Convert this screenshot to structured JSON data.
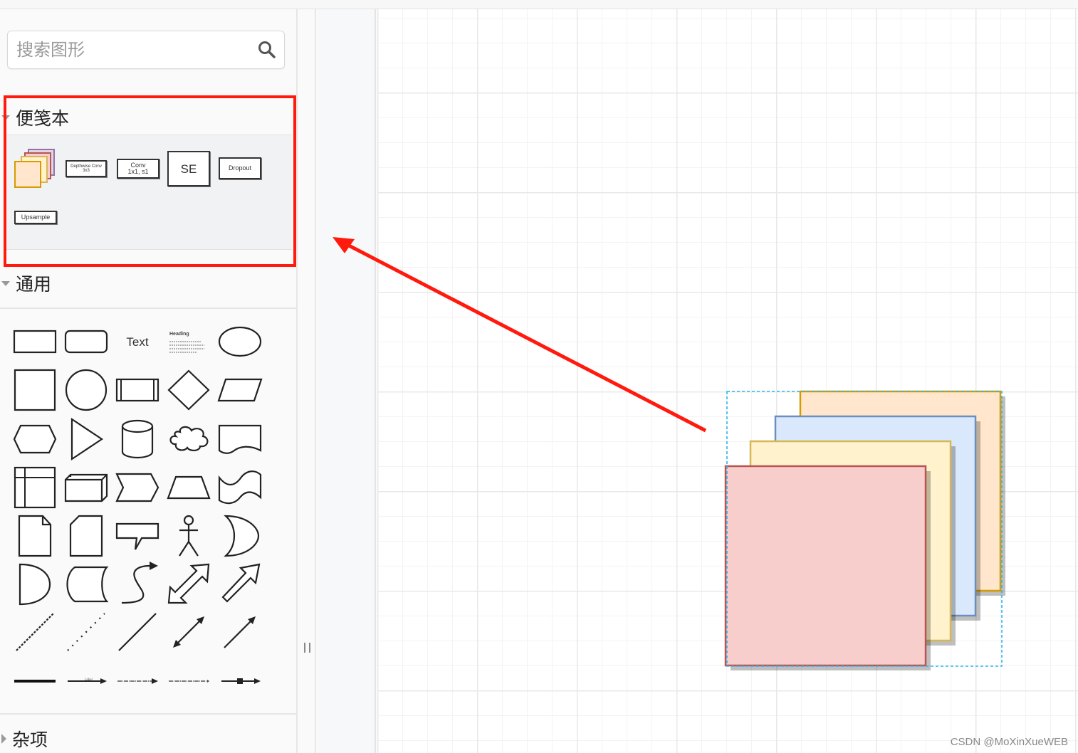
{
  "search": {
    "placeholder": "搜索图形",
    "icon": "search-icon"
  },
  "scratchpad": {
    "title": "便笺本",
    "expanded": true,
    "actions": [
      {
        "name": "help",
        "glyph": "?"
      },
      {
        "name": "add",
        "glyph": "+"
      },
      {
        "name": "edit",
        "glyph": "✎"
      },
      {
        "name": "close",
        "glyph": "✕"
      }
    ],
    "items": [
      {
        "name": "stacked-feature-maps",
        "label": ""
      },
      {
        "name": "depthwise-conv",
        "label": "Depthwise Conv\n3x3"
      },
      {
        "name": "conv-1x1",
        "label": "Conv\n1x1, s1"
      },
      {
        "name": "se",
        "label": "SE"
      },
      {
        "name": "dropout",
        "label": "Dropout"
      },
      {
        "name": "upsample",
        "label": "Upsample"
      }
    ],
    "highlight_color": "#ff1a0d"
  },
  "general": {
    "title": "通用",
    "expanded": true,
    "shapes": [
      "rectangle",
      "rounded-rectangle",
      "text",
      "textbox",
      "ellipse",
      "square",
      "circle",
      "process",
      "diamond",
      "parallelogram",
      "hexagon",
      "triangle",
      "cylinder",
      "cloud",
      "document",
      "internal-storage",
      "cube",
      "step",
      "trapezoid",
      "tape",
      "note",
      "card",
      "callout",
      "actor",
      "or",
      "and",
      "data-storage",
      "curved-arrow",
      "bidirectional-arrow",
      "arrow",
      "dashed-line",
      "dotted-line",
      "line",
      "bidirectional-connector",
      "directional-connector",
      "link",
      "connector-with-label",
      "connector-with-2-labels",
      "connector-with-3-labels",
      "connector-with-symbol"
    ],
    "text_label": "Text",
    "heading_label": "Heading"
  },
  "misc": {
    "title": "杂项",
    "expanded": false
  },
  "canvas": {
    "shapes": [
      {
        "name": "layer-orange",
        "fill": "#ffe6cc",
        "stroke": "#d79b00"
      },
      {
        "name": "layer-blue",
        "fill": "#dae8fc",
        "stroke": "#6c8ebf"
      },
      {
        "name": "layer-yellow",
        "fill": "#fff2cc",
        "stroke": "#d6b656"
      },
      {
        "name": "layer-red",
        "fill": "#f8cecc",
        "stroke": "#b85450"
      }
    ],
    "selection_color": "#29b6f2",
    "annotation_arrow_color": "#ff1a0d"
  },
  "watermark": "CSDN @MoXinXueWEB"
}
